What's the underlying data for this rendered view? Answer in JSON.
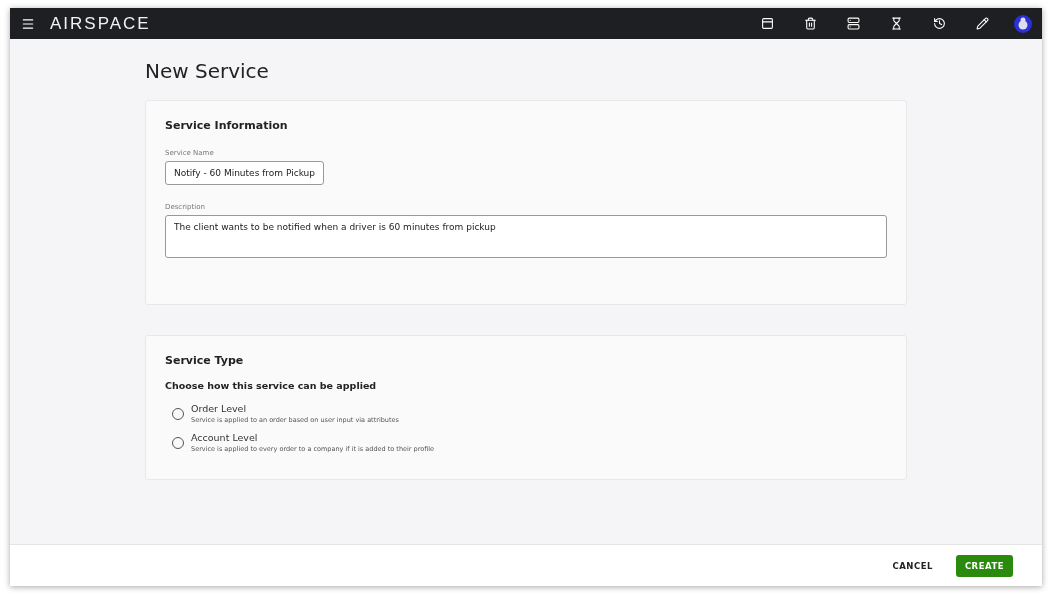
{
  "header": {
    "logo": "AIRSPACE"
  },
  "page_title": "New Service",
  "service_information": {
    "title": "Service Information",
    "fields": [
      {
        "label": "Service Name",
        "value": "Notify - 60 Minutes from Pickup",
        "kind": "input"
      },
      {
        "label": "Description",
        "value": "The client wants to be notified when a driver is 60 minutes from pickup",
        "kind": "textarea"
      }
    ]
  },
  "service_type": {
    "title": "Service Type",
    "prompt": "Choose how this service can be applied",
    "options": [
      {
        "label": "Order Level",
        "description": "Service is applied to an order based on user input via attributes",
        "selected": false
      },
      {
        "label": "Account Level",
        "description": "Service is applied to every order to a company if it is added to their profile",
        "selected": false
      }
    ]
  },
  "footer": {
    "buttons": [
      {
        "label": "CANCEL",
        "kind": "text"
      },
      {
        "label": "CREATE",
        "kind": "primary"
      }
    ]
  }
}
